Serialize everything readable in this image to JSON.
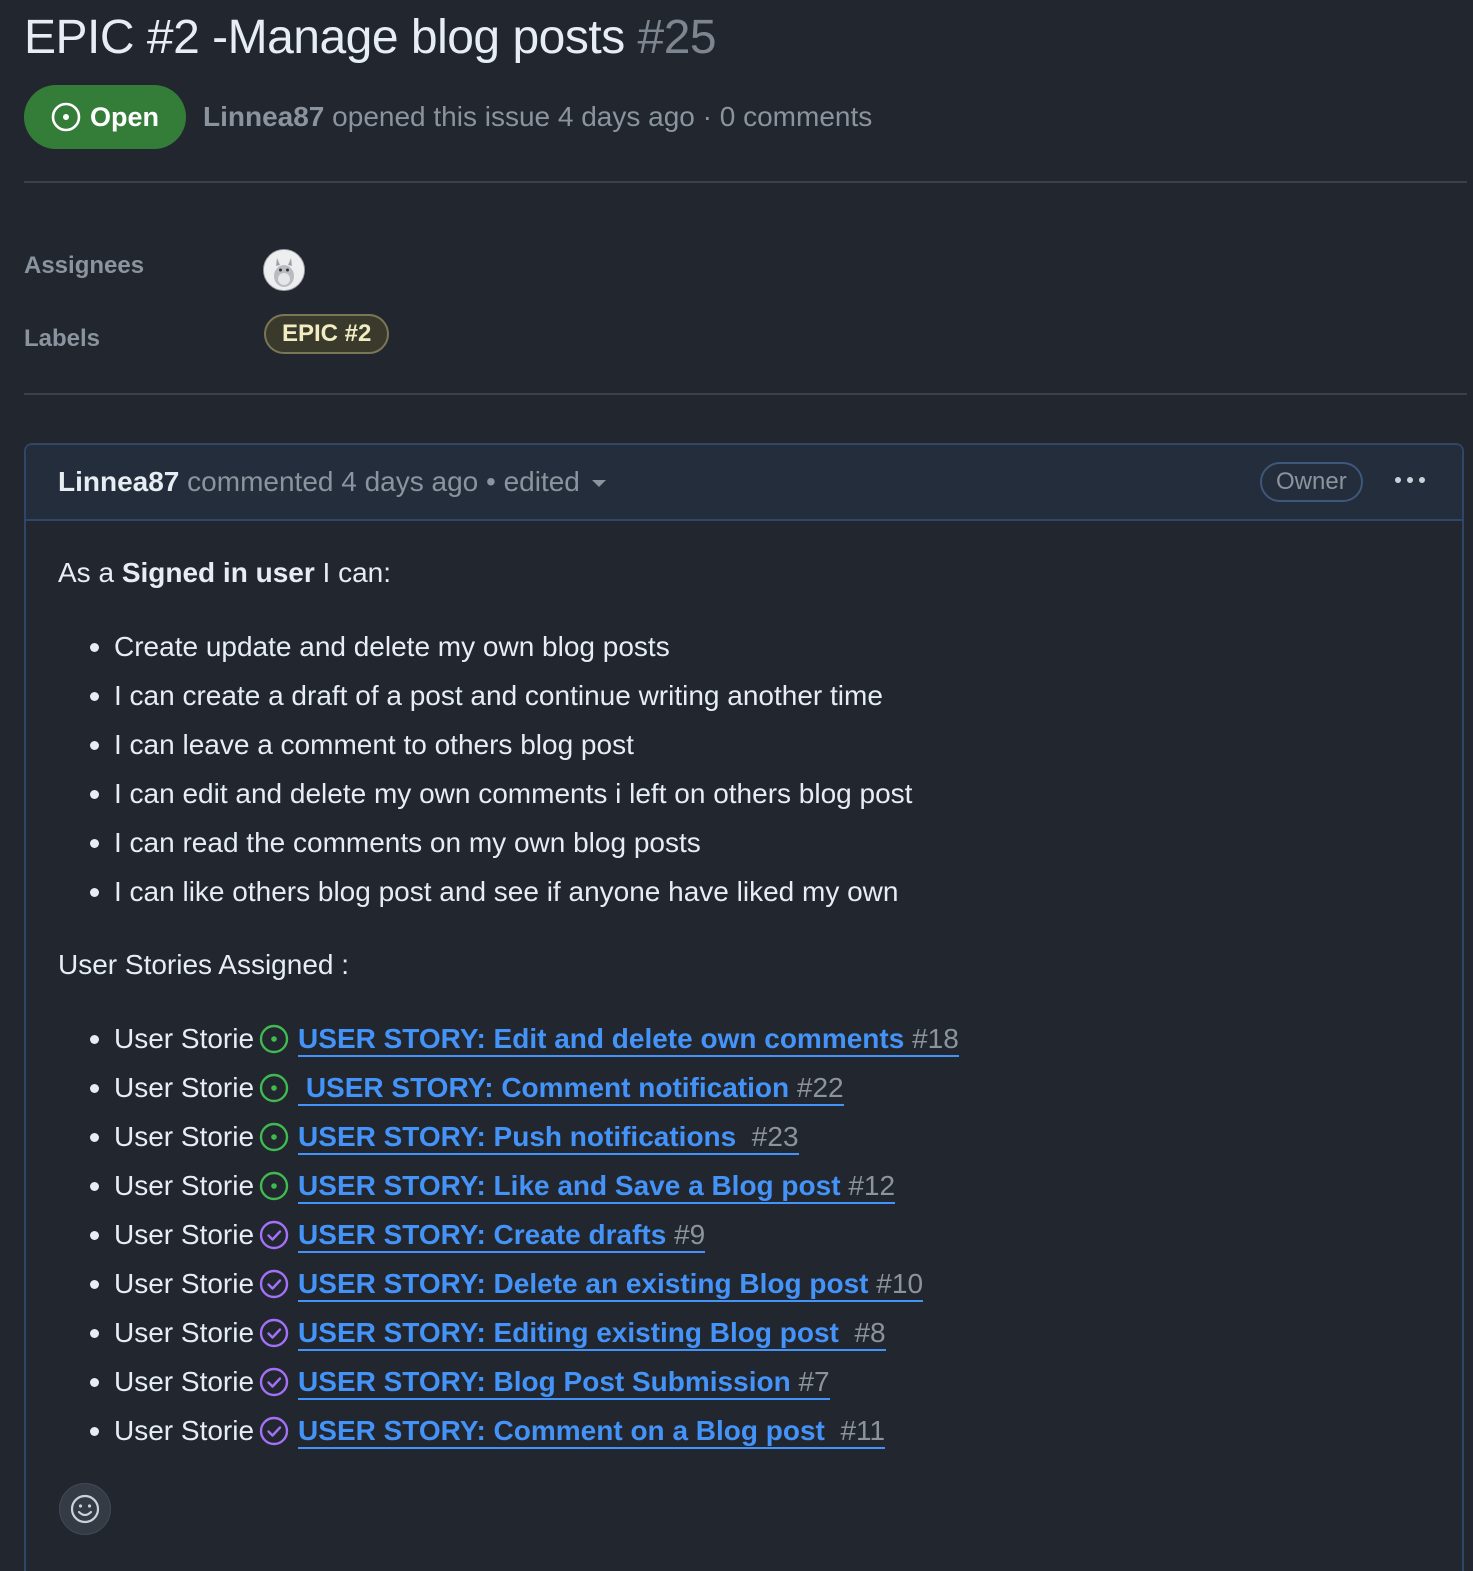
{
  "issue": {
    "title": "EPIC #2 -Manage blog posts",
    "number": "#25",
    "state": "Open",
    "author": "Linnea87",
    "meta_text": " opened this issue 4 days ago · 0 comments"
  },
  "sidebar": {
    "assignees_label": "Assignees",
    "labels_label": "Labels",
    "label_name": "EPIC #2",
    "label_color": "#f1ecc2"
  },
  "comment": {
    "author": "Linnea87",
    "meta_text": " commented 4 days ago • edited",
    "owner_badge": "Owner",
    "intro_prefix": "As a ",
    "intro_bold": "Signed in user",
    "intro_suffix": " I can:",
    "abilities": [
      "Create update and delete my own blog posts",
      "I can create a draft of a post and continue writing another time",
      "I can leave a comment to others blog post",
      "I can edit and delete my own comments i left on others blog post",
      "I can read the comments on my own blog posts",
      "I can like others blog post and see if anyone have liked my own"
    ],
    "stories_heading": "User Stories Assigned :",
    "story_prefix": "User Storie",
    "stories": [
      {
        "title": "USER STORY: Edit and delete own comments",
        "number": "#18",
        "state": "open"
      },
      {
        "title": " USER STORY: Comment notification",
        "number": "#22",
        "state": "open"
      },
      {
        "title": "USER STORY: Push notifications ",
        "number": "#23",
        "state": "open"
      },
      {
        "title": "USER STORY: Like and Save a Blog post",
        "number": "#12",
        "state": "open"
      },
      {
        "title": "USER STORY: Create drafts",
        "number": "#9",
        "state": "closed"
      },
      {
        "title": "USER STORY: Delete an existing Blog post",
        "number": "#10",
        "state": "closed"
      },
      {
        "title": "USER STORY: Editing existing Blog post ",
        "number": "#8",
        "state": "closed"
      },
      {
        "title": "USER STORY: Blog Post Submission",
        "number": "#7",
        "state": "closed"
      },
      {
        "title": "USER STORY: Comment on a Blog post ",
        "number": "#11",
        "state": "closed"
      }
    ]
  },
  "colors": {
    "open": "#3fb950",
    "closed": "#a371f7",
    "link": "#4493f8"
  }
}
